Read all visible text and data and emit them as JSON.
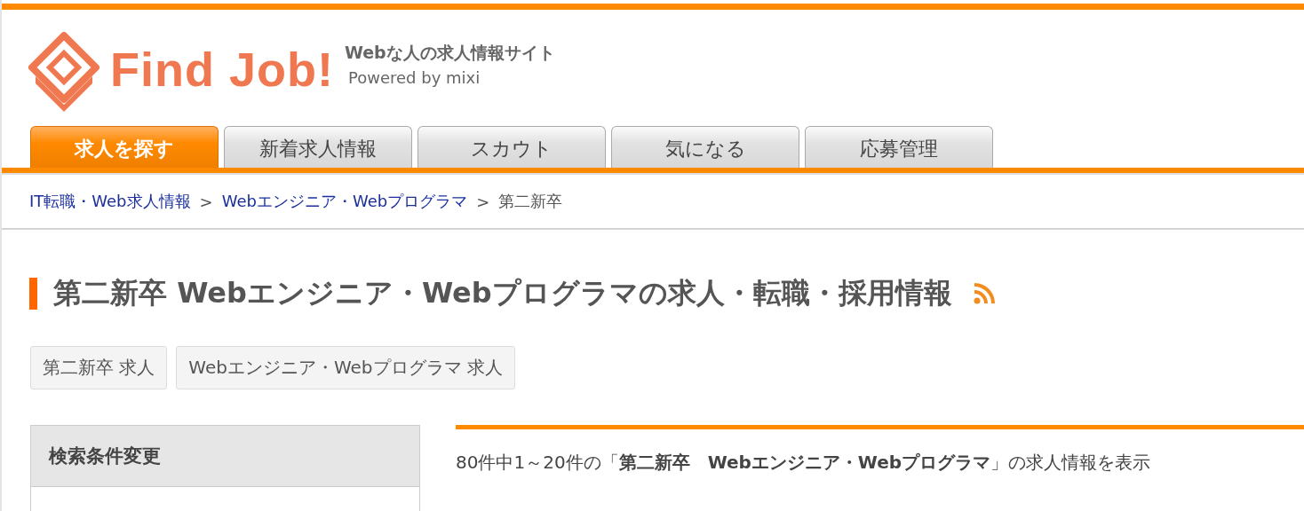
{
  "logo": {
    "name": "Find Job!",
    "tagline": "Webな人の求人情報サイト",
    "powered": "Powered by mixi"
  },
  "tabs": [
    {
      "label": "求人を探す",
      "selected": true
    },
    {
      "label": "新着求人情報",
      "selected": false
    },
    {
      "label": "スカウト",
      "selected": false
    },
    {
      "label": "気になる",
      "selected": false
    },
    {
      "label": "応募管理",
      "selected": false
    }
  ],
  "breadcrumb": [
    {
      "kind": "link",
      "label": "IT転職・Web求人情報"
    },
    {
      "kind": "separator",
      "label": ">"
    },
    {
      "kind": "link",
      "label": "Webエンジニア・Webプログラマ"
    },
    {
      "kind": "separator",
      "label": ">"
    },
    {
      "kind": "current",
      "label": "第二新卒"
    }
  ],
  "heading": "第二新卒 Webエンジニア・Webプログラマの求人・転職・採用情報",
  "tags": [
    "第二新卒 求人",
    "Webエンジニア・Webプログラマ 求人"
  ],
  "sidebar": {
    "title": "検索条件変更"
  },
  "results": {
    "summary": "80件中1～20件の「**第二新卒　Webエンジニア・Webプログラマ**」の求人情報を表示"
  }
}
